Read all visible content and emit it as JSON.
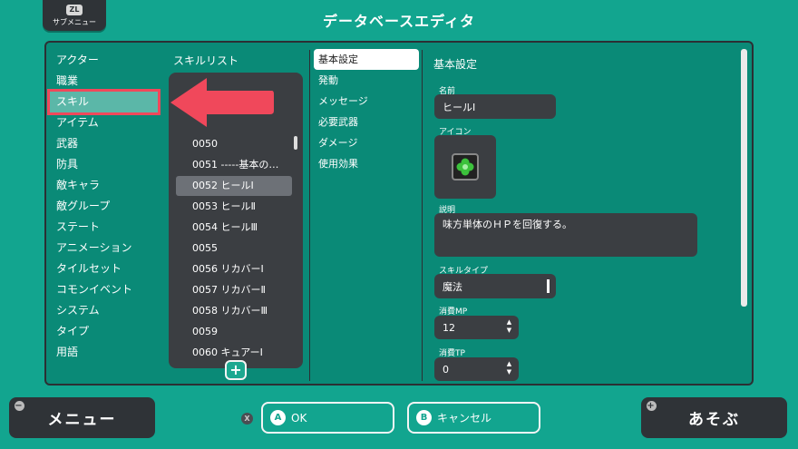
{
  "header": {
    "submenu_badge": "ZL",
    "submenu_label": "サブメニュー",
    "title": "データベースエディタ"
  },
  "categories": [
    {
      "label": "アクター"
    },
    {
      "label": "職業"
    },
    {
      "label": "スキル",
      "selected": true
    },
    {
      "label": "アイテム"
    },
    {
      "label": "武器"
    },
    {
      "label": "防具"
    },
    {
      "label": "敵キャラ"
    },
    {
      "label": "敵グループ"
    },
    {
      "label": "ステート"
    },
    {
      "label": "アニメーション"
    },
    {
      "label": "タイルセット"
    },
    {
      "label": "コモンイベント"
    },
    {
      "label": "システム"
    },
    {
      "label": "タイプ"
    },
    {
      "label": "用語"
    }
  ],
  "skill_list": {
    "header": "スキルリスト",
    "items": [
      {
        "label": "0050"
      },
      {
        "label": "0051 -----基本の…"
      },
      {
        "label": "0052 ヒールⅠ",
        "selected": true
      },
      {
        "label": "0053 ヒールⅡ"
      },
      {
        "label": "0054 ヒールⅢ"
      },
      {
        "label": "0055"
      },
      {
        "label": "0056 リカバーⅠ"
      },
      {
        "label": "0057 リカバーⅡ"
      },
      {
        "label": "0058 リカバーⅢ"
      },
      {
        "label": "0059"
      },
      {
        "label": "0060 キュアーⅠ"
      }
    ],
    "add_label": "+"
  },
  "tabs": [
    {
      "label": "基本設定",
      "selected": true
    },
    {
      "label": "発動"
    },
    {
      "label": "メッセージ"
    },
    {
      "label": "必要武器"
    },
    {
      "label": "ダメージ"
    },
    {
      "label": "使用効果"
    }
  ],
  "detail": {
    "title": "基本設定",
    "name_label": "名前",
    "name_value": "ヒールⅠ",
    "icon_label": "アイコン",
    "icon_name": "clover-icon",
    "description_label": "説明",
    "description_value": "味方単体のＨＰを回復する。",
    "skill_type_label": "スキルタイプ",
    "skill_type_value": "魔法",
    "mp_label": "消費MP",
    "mp_value": "12",
    "tp_label": "消費TP",
    "tp_value": "0"
  },
  "footer": {
    "menu_label": "メニュー",
    "menu_key": "−",
    "x_key": "X",
    "ok_key": "A",
    "ok_label": "OK",
    "cancel_key": "B",
    "cancel_label": "キャンセル",
    "play_label": "あそぶ",
    "play_key": "+"
  },
  "colors": {
    "background": "#12a58f",
    "panel": "#0a8a77",
    "dark": "#3b3e42",
    "highlight_arrow": "#f0485b"
  }
}
